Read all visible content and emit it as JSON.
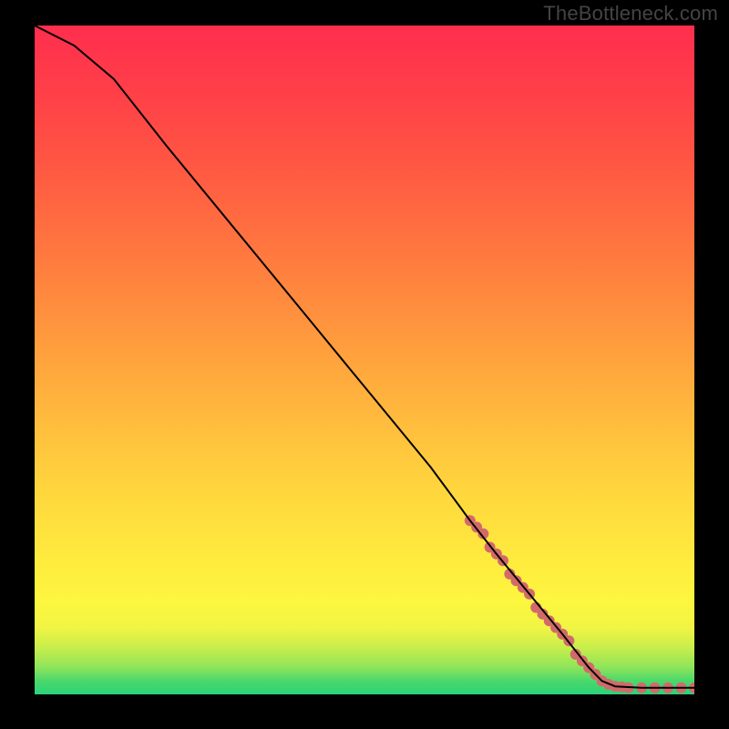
{
  "watermark": "TheBottleneck.com",
  "chart_data": {
    "type": "line",
    "title": "",
    "xlabel": "",
    "ylabel": "",
    "xlim": [
      0,
      100
    ],
    "ylim": [
      0,
      100
    ],
    "gradient": {
      "direction": "vertical",
      "stops": [
        {
          "pos": 0,
          "color": "#2BD27A"
        },
        {
          "pos": 2,
          "color": "#4AD86B"
        },
        {
          "pos": 4,
          "color": "#8DE45A"
        },
        {
          "pos": 7,
          "color": "#C8EE4B"
        },
        {
          "pos": 10,
          "color": "#F1F444"
        },
        {
          "pos": 14,
          "color": "#FDF63F"
        },
        {
          "pos": 20,
          "color": "#FFEB3E"
        },
        {
          "pos": 30,
          "color": "#FFD73D"
        },
        {
          "pos": 40,
          "color": "#FFBE3D"
        },
        {
          "pos": 50,
          "color": "#FFA33D"
        },
        {
          "pos": 60,
          "color": "#FF883E"
        },
        {
          "pos": 70,
          "color": "#FF6E40"
        },
        {
          "pos": 80,
          "color": "#FF5543"
        },
        {
          "pos": 90,
          "color": "#FF3F48"
        },
        {
          "pos": 100,
          "color": "#FF2E4E"
        }
      ]
    },
    "series": [
      {
        "name": "curve",
        "color": "#000000",
        "stroke_width": 2,
        "points": [
          {
            "x": 0,
            "y": 100
          },
          {
            "x": 6,
            "y": 97
          },
          {
            "x": 12,
            "y": 92
          },
          {
            "x": 20,
            "y": 82
          },
          {
            "x": 30,
            "y": 70
          },
          {
            "x": 40,
            "y": 58
          },
          {
            "x": 50,
            "y": 46
          },
          {
            "x": 60,
            "y": 34
          },
          {
            "x": 66,
            "y": 26
          },
          {
            "x": 70,
            "y": 21
          },
          {
            "x": 75,
            "y": 15
          },
          {
            "x": 80,
            "y": 9
          },
          {
            "x": 84,
            "y": 4
          },
          {
            "x": 86,
            "y": 2
          },
          {
            "x": 88,
            "y": 1.2
          },
          {
            "x": 92,
            "y": 1.0
          },
          {
            "x": 96,
            "y": 1.0
          },
          {
            "x": 100,
            "y": 1.0
          }
        ]
      }
    ],
    "markers": [
      {
        "x": 66,
        "y": 26
      },
      {
        "x": 67,
        "y": 25
      },
      {
        "x": 68,
        "y": 24
      },
      {
        "x": 69,
        "y": 22
      },
      {
        "x": 70,
        "y": 21
      },
      {
        "x": 71,
        "y": 20
      },
      {
        "x": 72,
        "y": 18
      },
      {
        "x": 73,
        "y": 17
      },
      {
        "x": 74,
        "y": 16
      },
      {
        "x": 75,
        "y": 15
      },
      {
        "x": 76,
        "y": 13
      },
      {
        "x": 77,
        "y": 12
      },
      {
        "x": 78,
        "y": 11
      },
      {
        "x": 79,
        "y": 10
      },
      {
        "x": 80,
        "y": 9
      },
      {
        "x": 81,
        "y": 8
      },
      {
        "x": 82,
        "y": 6
      },
      {
        "x": 83,
        "y": 5
      },
      {
        "x": 84,
        "y": 4
      },
      {
        "x": 85,
        "y": 3
      },
      {
        "x": 86,
        "y": 2
      },
      {
        "x": 87,
        "y": 1.5
      },
      {
        "x": 88,
        "y": 1.2
      },
      {
        "x": 89,
        "y": 1.1
      },
      {
        "x": 90,
        "y": 1.0
      },
      {
        "x": 92,
        "y": 1.0
      },
      {
        "x": 94,
        "y": 1.0
      },
      {
        "x": 96,
        "y": 1.0
      },
      {
        "x": 98,
        "y": 1.0
      },
      {
        "x": 100,
        "y": 1.0
      }
    ],
    "marker_style": {
      "color": "#D26A6A",
      "radius": 6
    }
  }
}
